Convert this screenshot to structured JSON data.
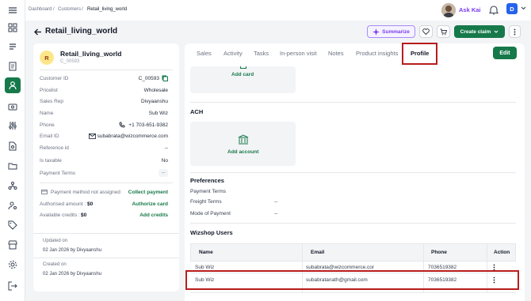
{
  "breadcrumb": {
    "items": [
      "Dashboard",
      "Customers",
      "Retail_living_world"
    ],
    "sep": "/"
  },
  "topbar": {
    "user_name": "Ask Kai",
    "account_initial": "D"
  },
  "header": {
    "title": "Retail_living_world",
    "summarize_label": "Summarize",
    "create_claim_label": "Create claim"
  },
  "customer": {
    "avatar_initial": "R",
    "name": "Retail_living_world",
    "code": "C_00593",
    "fields": [
      {
        "label": "Customer ID",
        "value": "C_00593"
      },
      {
        "label": "Pricelist",
        "value": "Wholesale"
      },
      {
        "label": "Sales Rep",
        "value": "Divyaanshu"
      },
      {
        "label": "Name",
        "value": "Sub Wiz"
      },
      {
        "label": "Phone",
        "value": "+1 703-651-9382"
      },
      {
        "label": "Email ID",
        "value": "subabrata@wizcommerce.com"
      },
      {
        "label": "Reference id",
        "value": "--"
      },
      {
        "label": "Is taxable",
        "value": "No"
      },
      {
        "label": "Payment Terms",
        "value": "--"
      }
    ],
    "payment_method_label": "Payment method not assigned",
    "collect_payment": "Collect payment",
    "authorised_label": "Authorised amount : ",
    "authorised_value": "$0",
    "authorize_card": "Authorize card",
    "available_label": "Available credits : ",
    "available_value": "$0",
    "add_credits": "Add credits",
    "updated_on_label": "Updated on",
    "updated_on_value": "02 Jan 2026 by Divyaanshu",
    "created_on_label": "Created on",
    "created_on_value": "02 Jan 2026 by Divyaanshu"
  },
  "tabs": [
    "Sales",
    "Activity",
    "Tasks",
    "In-person visit",
    "Notes",
    "Product insights",
    "Profile"
  ],
  "active_tab": "Profile",
  "edit_label": "Edit",
  "add_card_label": "Add card",
  "ach": {
    "title": "ACH",
    "add_account_label": "Add account"
  },
  "preferences": {
    "title": "Preferences",
    "items": [
      {
        "label": "Payment Terms",
        "value": ""
      },
      {
        "label": "Freight Terms",
        "value": "--"
      },
      {
        "label": "Mode of Payment",
        "value": "--"
      }
    ]
  },
  "wizshop": {
    "title": "Wizshop Users",
    "columns": [
      "Name",
      "Email",
      "Phone",
      "Action"
    ],
    "rows": [
      {
        "name": "Sub Wiz",
        "email": "subabrata@wizcommerce.cor",
        "phone": "7036519382"
      },
      {
        "name": "Sub Wiz",
        "email": "subabratanath@gmail.com",
        "phone": "7036519382"
      }
    ]
  },
  "colors": {
    "primary": "#16794a",
    "highlight": "#b91c1c",
    "summarize": "#7c3aed",
    "avatar_bg": "#fde68a"
  }
}
